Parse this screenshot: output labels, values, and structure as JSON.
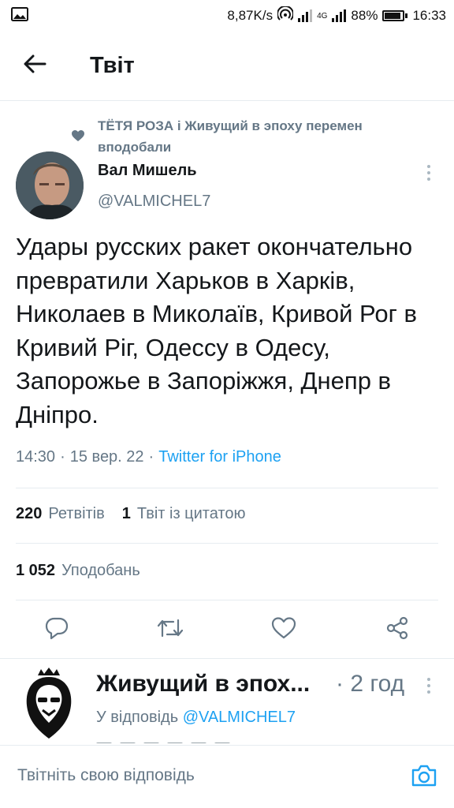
{
  "status_bar": {
    "net_speed": "8,87K/s",
    "battery_pct": "88%",
    "time": "16:33",
    "net_type": "4G",
    "icons": [
      "image-icon",
      "hotspot-icon",
      "signal-icon",
      "battery-icon"
    ]
  },
  "header": {
    "title": "Твіт",
    "back_icon": "arrow-left-icon"
  },
  "tweet": {
    "liked_by": "ТЁТЯ РОЗА і Живущий в эпоху перемен вподобали",
    "author_name": "Вал Мишель",
    "author_handle": "@VALMICHEL7",
    "text": "Удары русских ракет окончательно превратили Харьков в Харків, Николаев в Миколаїв, Кривой Рог в Кривий Ріг, Одессу в Одесу, Запорожье в Запоріжжя, Днепр в Дніпро.",
    "time": "14:30",
    "date": "15 вер. 22",
    "source": "Twitter for iPhone",
    "retweets_count": "220",
    "retweets_label": "Ретвітів",
    "quotes_count": "1",
    "quotes_label": "Твіт із цитатою",
    "likes_count": "1 052",
    "likes_label": "Уподобань"
  },
  "actions": [
    "reply-icon",
    "retweet-icon",
    "like-icon",
    "share-icon"
  ],
  "reply": {
    "name": "Живущий в эпох...",
    "time": "· 2 год",
    "reply_prefix": "У відповідь",
    "reply_handle": "@VALMICHEL7"
  },
  "compose": {
    "placeholder": "Твітніть свою відповідь"
  },
  "colors": {
    "accent": "#1da1f2",
    "secondary_text": "#657786",
    "divider": "#e6ecf0"
  }
}
